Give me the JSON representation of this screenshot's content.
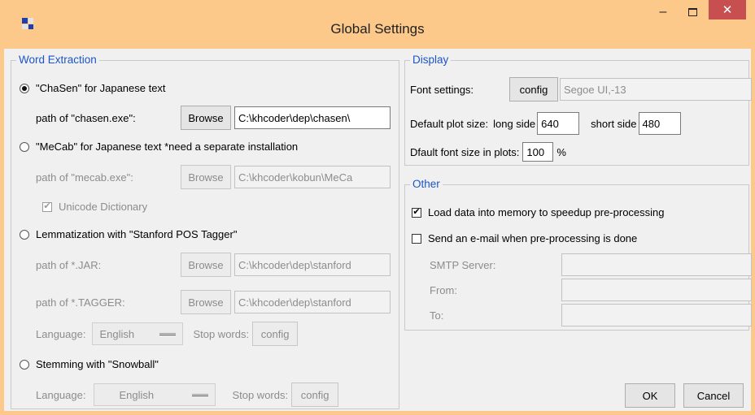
{
  "window": {
    "title": "Global Settings",
    "app_icon": "grid-app-icon",
    "controls": {
      "minimize": "–",
      "close": "✕"
    },
    "accent_color": "#fdc98a"
  },
  "word_extraction": {
    "legend": "Word Extraction",
    "chasen": {
      "label": "\"ChaSen\" for Japanese text",
      "selected": true,
      "path_label": "path of \"chasen.exe\":",
      "browse": "Browse",
      "path_value": "C:\\khcoder\\dep\\chasen\\"
    },
    "mecab": {
      "label": "\"MeCab\" for Japanese text *need a separate installation",
      "selected": false,
      "path_label": "path of \"mecab.exe\":",
      "browse": "Browse",
      "path_value": "C:\\khcoder\\kobun\\MeCa",
      "unicode_label": "Unicode Dictionary",
      "unicode_checked": true
    },
    "stanford": {
      "label": "Lemmatization with \"Stanford POS Tagger\"",
      "selected": false,
      "jar_label": "path of *.JAR:",
      "jar_browse": "Browse",
      "jar_value": "C:\\khcoder\\dep\\stanford",
      "tagger_label": "path of *.TAGGER:",
      "tagger_browse": "Browse",
      "tagger_value": "C:\\khcoder\\dep\\stanford",
      "language_label": "Language:",
      "language_value": "English",
      "stop_label": "Stop words:",
      "stop_button": "config"
    },
    "snowball": {
      "label": "Stemming with \"Snowball\"",
      "selected": false,
      "language_label": "Language:",
      "language_value": "English",
      "stop_label": "Stop words:",
      "stop_button": "config"
    }
  },
  "display": {
    "legend": "Display",
    "font_label": "Font settings:",
    "font_button": "config",
    "font_value": "Segoe UI,-13",
    "plot_size_label": "Default plot size:",
    "long_label": "long side",
    "long_value": "640",
    "short_label": "short side",
    "short_value": "480",
    "font_size_label": "Dfault font size in plots:",
    "font_size_value": "100",
    "font_size_unit": "%"
  },
  "other": {
    "legend": "Other",
    "load_memory_label": "Load data into memory to speedup pre-processing",
    "load_memory_checked": true,
    "send_email_label": "Send an e-mail when pre-processing is done",
    "send_email_checked": false,
    "smtp_label": "SMTP Server:",
    "from_label": "From:",
    "to_label": "To:"
  },
  "buttons": {
    "ok": "OK",
    "cancel": "Cancel"
  }
}
